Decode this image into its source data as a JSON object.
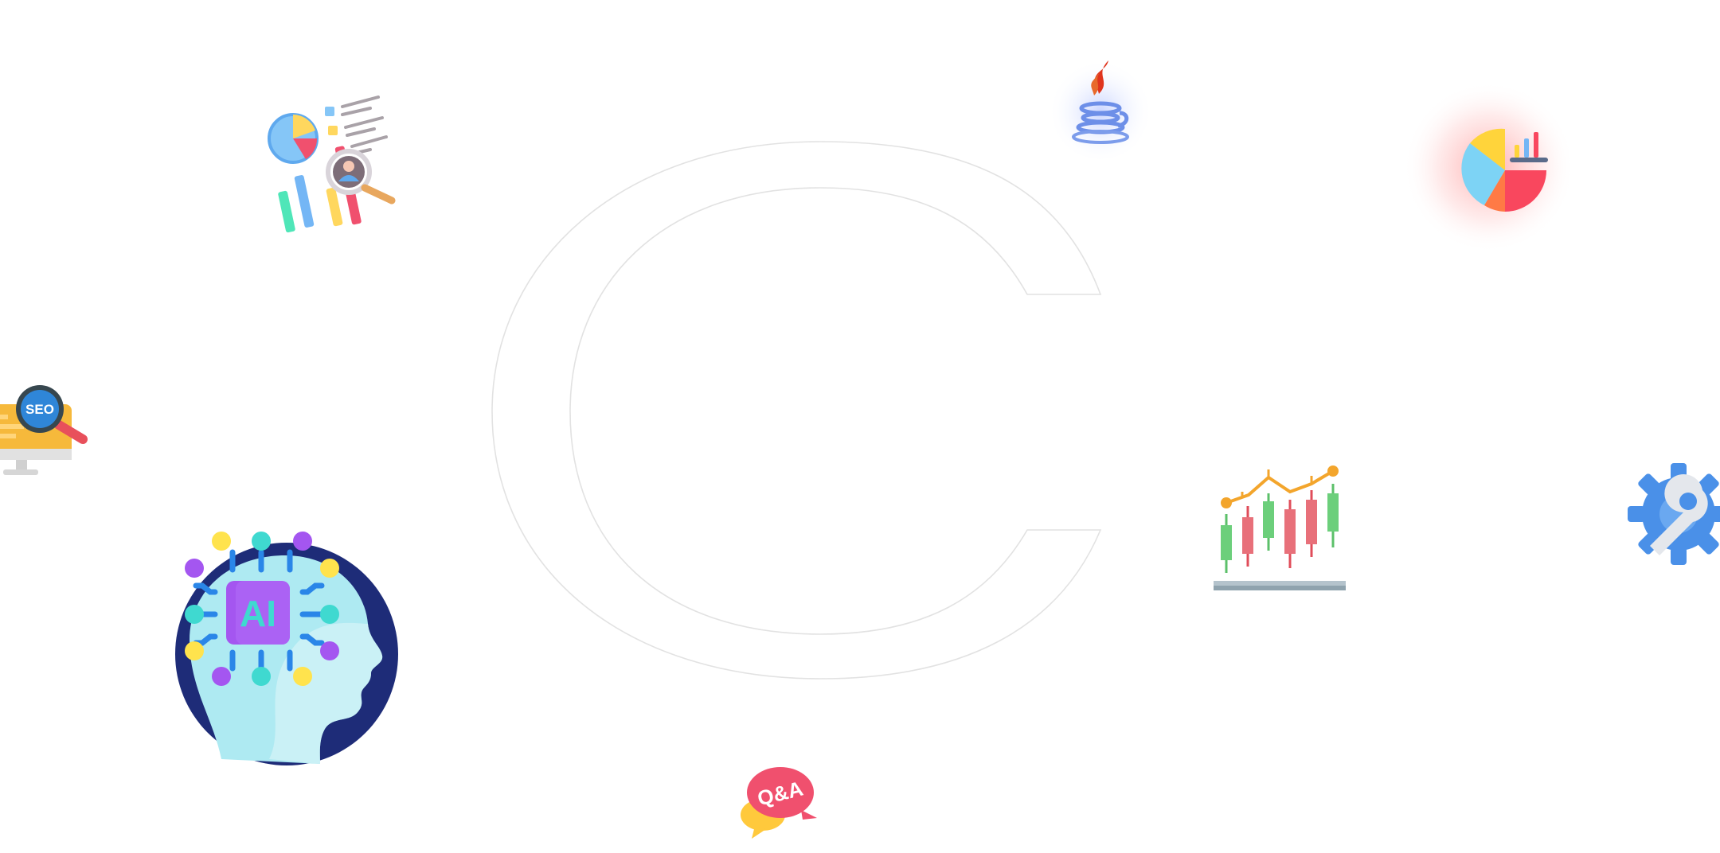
{
  "background": {
    "letter": "C",
    "letter_stroke_color": "#e2e2e2"
  },
  "icons": [
    {
      "name": "data-analytics-icon"
    },
    {
      "name": "java-icon"
    },
    {
      "name": "pie-chart-icon"
    },
    {
      "name": "seo-icon",
      "label": "SEO"
    },
    {
      "name": "candlestick-chart-icon"
    },
    {
      "name": "settings-wrench-icon"
    },
    {
      "name": "ai-brain-icon",
      "label": "AI"
    },
    {
      "name": "qa-chat-icon",
      "label": "Q&A"
    }
  ],
  "colors": {
    "java_glow": "#9fb3ff",
    "pie_glow": "#ff6b6b",
    "navy": "#1e2c78",
    "purple": "#a456f0",
    "teal": "#3fd9d0",
    "yellow": "#ffe34d",
    "pink": "#f0506e"
  }
}
